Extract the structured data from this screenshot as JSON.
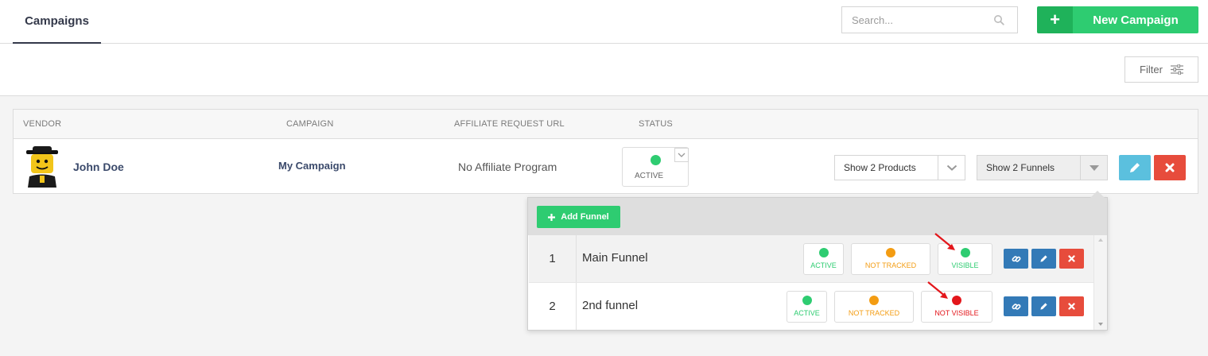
{
  "header": {
    "tab_label": "Campaigns",
    "search_placeholder": "Search...",
    "new_button_label": "New Campaign"
  },
  "filter": {
    "label": "Filter"
  },
  "table": {
    "columns": [
      "VENDOR",
      "CAMPAIGN",
      "AFFILIATE REQUEST URL",
      "STATUS"
    ],
    "row": {
      "vendor": "John Doe",
      "campaign": "My Campaign",
      "affiliate_url": "No Affiliate Program",
      "status": "ACTIVE",
      "products_select": "Show 2 Products",
      "funnels_select": "Show 2 Funnels"
    }
  },
  "funnel_panel": {
    "add_label": "Add Funnel",
    "funnels": [
      {
        "num": "1",
        "name": "Main Funnel",
        "status": "ACTIVE",
        "tracking": "NOT TRACKED",
        "visibility": "VISIBLE"
      },
      {
        "num": "2",
        "name": "2nd funnel",
        "status": "ACTIVE",
        "tracking": "NOT TRACKED",
        "visibility": "NOT VISIBLE"
      }
    ]
  },
  "colors": {
    "green": "#2ecc71",
    "orange": "#f39c12",
    "red": "#e3161b",
    "blue": "#337ab7",
    "danger": "#e74c3c",
    "info": "#5bc0de"
  }
}
